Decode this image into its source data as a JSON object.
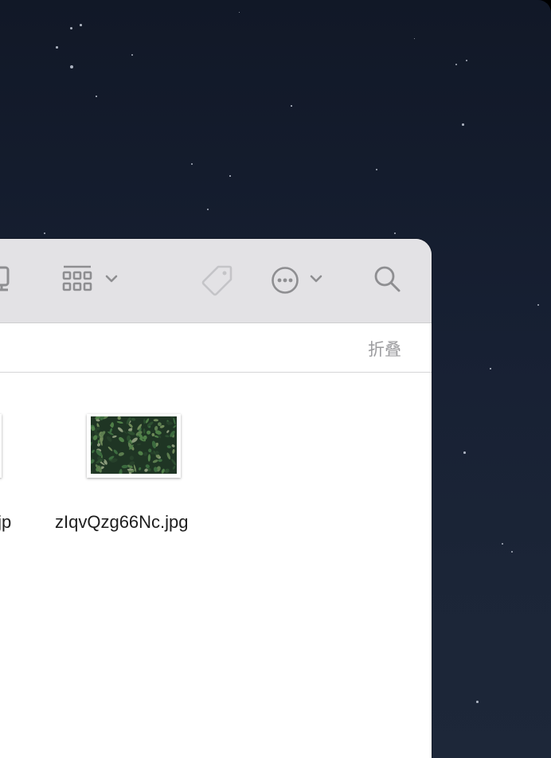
{
  "toolbar": {
    "icons": [
      "device-icon",
      "icon-view-grid-icon",
      "chevron-down-icon",
      "tag-icon",
      "more-actions-icon",
      "chevron-down-icon",
      "search-icon"
    ]
  },
  "pathbar": {
    "collapse_label": "折叠"
  },
  "files": [
    {
      "name": "k.jp"
    },
    {
      "name": "zIqvQzg66Nc.jpg"
    }
  ],
  "colors": {
    "toolbar_bg": "#e3e2e5",
    "icon_gray": "#8e8e91",
    "icon_light": "#c4c4c7",
    "desktop_top": "#111827",
    "desktop_bottom": "#1d2739"
  }
}
